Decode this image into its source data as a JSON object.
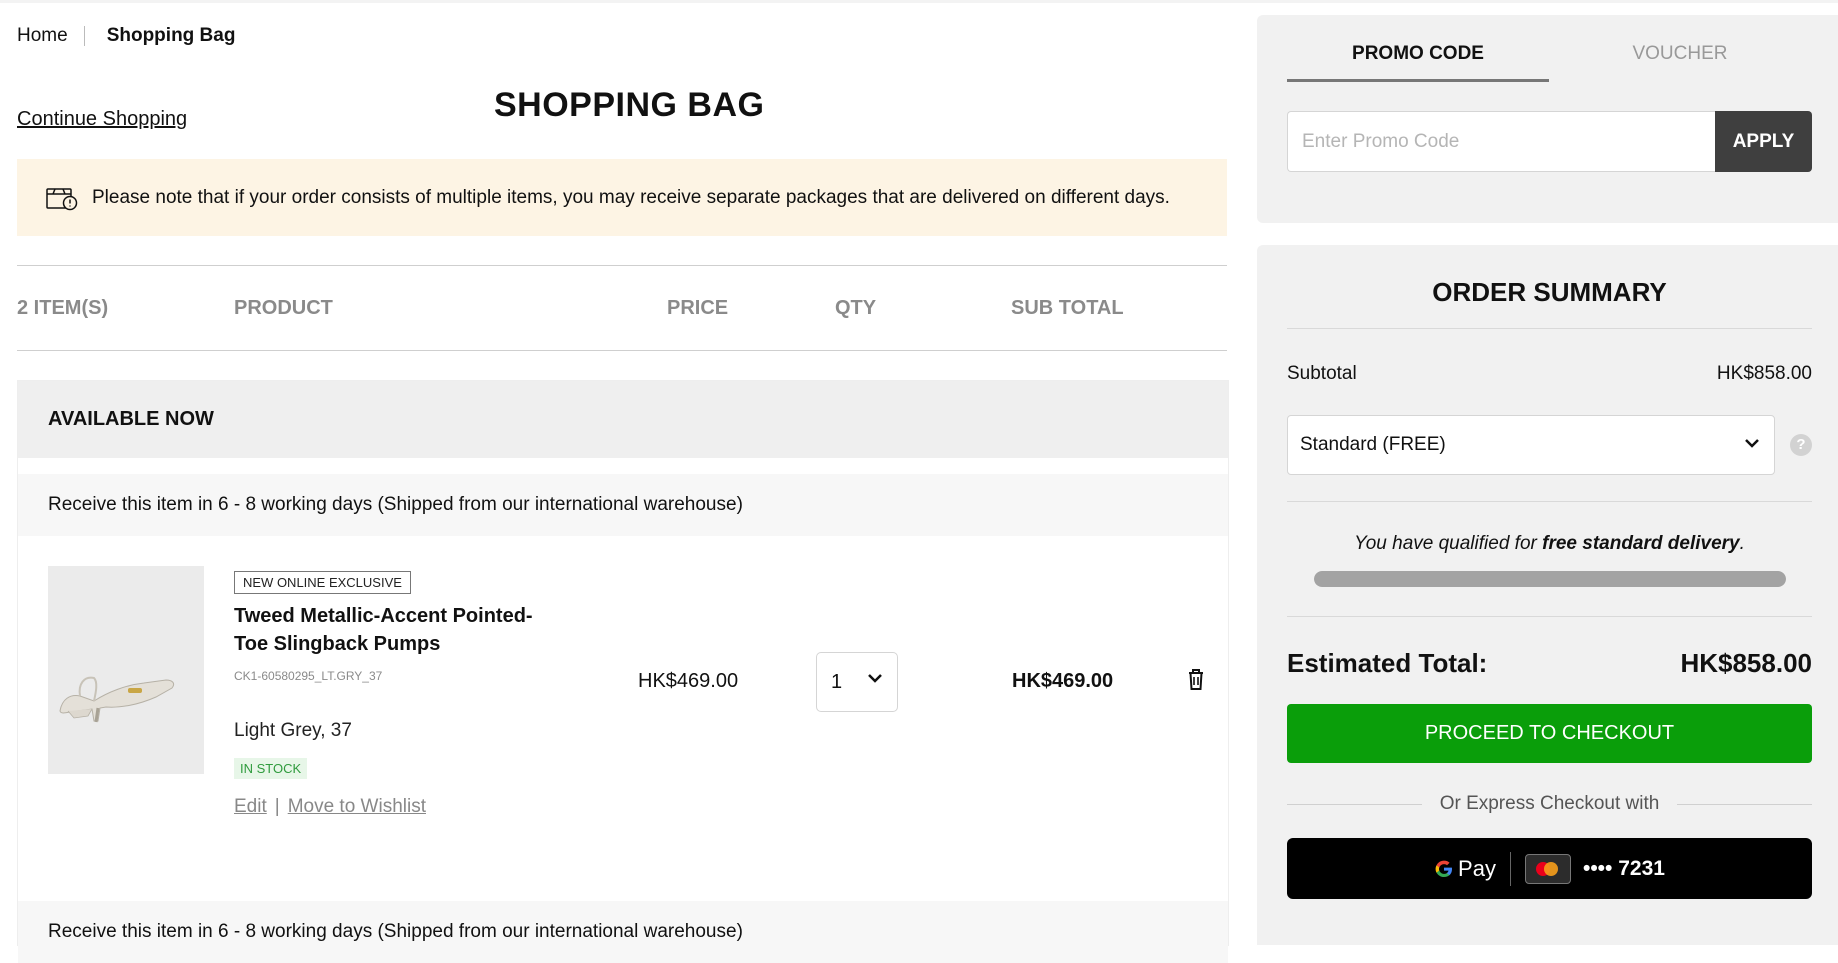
{
  "breadcrumb": {
    "home": "Home",
    "current": "Shopping Bag"
  },
  "header": {
    "continue_shopping": "Continue Shopping",
    "title": "SHOPPING BAG"
  },
  "notice": {
    "text": "Please note that if your order consists of multiple items, you may receive separate packages that are delivered on different days."
  },
  "table": {
    "columns": [
      "2 ITEM(S)",
      "PRODUCT",
      "PRICE",
      "QTY",
      "SUB TOTAL"
    ]
  },
  "section": {
    "title": "AVAILABLE NOW",
    "shipping_text": "Receive this item in 6 - 8 working days (Shipped from our international warehouse)"
  },
  "items": [
    {
      "badge": "NEW ONLINE EXCLUSIVE",
      "name": "Tweed Metallic-Accent Pointed-Toe Slingback Pumps",
      "sku": "CK1-60580295_LT.GRY_37",
      "variant": "Light Grey, 37",
      "stock": "IN STOCK",
      "price": "HK$469.00",
      "qty": "1",
      "subtotal": "HK$469.00",
      "edit": "Edit",
      "separator": "|",
      "wishlist": "Move to Wishlist"
    }
  ],
  "promo": {
    "tab_promo": "PROMO CODE",
    "tab_voucher": "VOUCHER",
    "placeholder": "Enter Promo Code",
    "apply": "APPLY"
  },
  "summary": {
    "title": "ORDER SUMMARY",
    "subtotal_label": "Subtotal",
    "subtotal_value": "HK$858.00",
    "shipping_option": "Standard (FREE)",
    "help": "?",
    "qualified_prefix": "You have qualified for ",
    "qualified_bold": "free standard delivery",
    "qualified_suffix": ".",
    "progress_percent": 100,
    "estimated_label": "Estimated Total:",
    "estimated_value": "HK$858.00",
    "checkout": "PROCEED TO CHECKOUT",
    "express_text": "Or Express Checkout with",
    "gpay_label": "Pay",
    "card_masked": "•••• 7231"
  },
  "colors": {
    "checkout_green": "#0a9e0a",
    "notice_bg": "#fdf4e4",
    "stock_green": "#2f9b3d"
  }
}
